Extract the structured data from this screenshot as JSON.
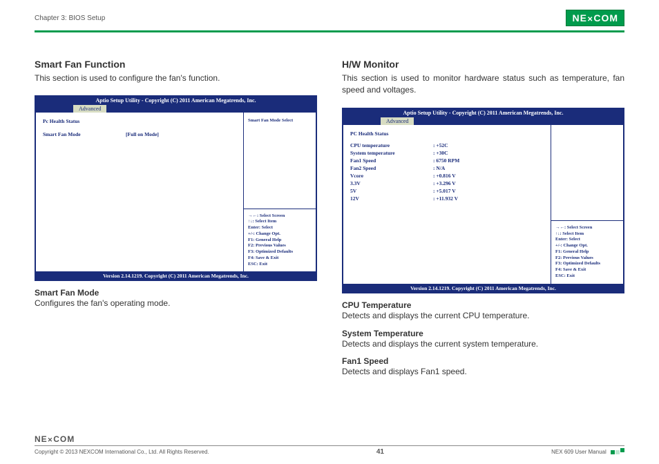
{
  "header": {
    "chapter": "Chapter 3: BIOS Setup",
    "brand": "NE COM"
  },
  "left": {
    "title": "Smart Fan Function",
    "desc": "This section is used to configure the fan's function.",
    "bios": {
      "top": "Aptio Setup Utility - Copyright (C) 2011 American Megatrends, Inc.",
      "tab": "Advanced",
      "heading": "Pc Health Status",
      "item_label": "Smart Fan Mode",
      "item_value": "[Full on Mode]",
      "side_hint": "Smart Fan Mode Select",
      "version": "Version 2.14.1219. Copyright (C) 2011 American Megatrends, Inc."
    },
    "subs": [
      {
        "t": "Smart Fan Mode",
        "d": "Configures the fan's operating mode."
      }
    ]
  },
  "right": {
    "title": "H/W Monitor",
    "desc": "This section is used to monitor hardware status such as temperature, fan speed and voltages.",
    "bios": {
      "top": "Aptio Setup Utility - Copyright (C) 2011 American Megatrends, Inc.",
      "tab": "Advanced",
      "heading": "PC Health Status",
      "rows": [
        {
          "k": "CPU temperature",
          "v": ":  +52C"
        },
        {
          "k": "System temperature",
          "v": ":  +30C"
        },
        {
          "k": "Fan1 Speed",
          "v": ":  6750 RPM"
        },
        {
          "k": "Fan2 Speed",
          "v": ":  N/A"
        },
        {
          "k": "Vcore",
          "v": ":  +0.816 V"
        },
        {
          "k": "3.3V",
          "v": ":  +3.296 V"
        },
        {
          "k": "5V",
          "v": ":  +5.017 V"
        },
        {
          "k": "12V",
          "v": ":  +11.932 V"
        }
      ],
      "version": "Version 2.14.1219. Copyright (C) 2011 American Megatrends, Inc."
    },
    "subs": [
      {
        "t": "CPU Temperature",
        "d": "Detects and displays the current CPU temperature."
      },
      {
        "t": "System Temperature",
        "d": "Detects and displays the current system temperature."
      },
      {
        "t": "Fan1 Speed",
        "d": "Detects and displays Fan1 speed."
      }
    ]
  },
  "help": {
    "l1": "→←: Select Screen",
    "l2": "↑↓: Select Item",
    "l3": "Enter: Select",
    "l4": "+/-: Change Opt.",
    "l5": "F1: General Help",
    "l6": "F2: Previous Values",
    "l7": "F3: Optimized Defaults",
    "l8": "F4: Save & Exit",
    "l9": "ESC: Exit"
  },
  "footer": {
    "brand": "NE COM",
    "copyright": "Copyright © 2013 NEXCOM International Co., Ltd. All Rights Reserved.",
    "page": "41",
    "manual": "NEX 609 User Manual"
  }
}
